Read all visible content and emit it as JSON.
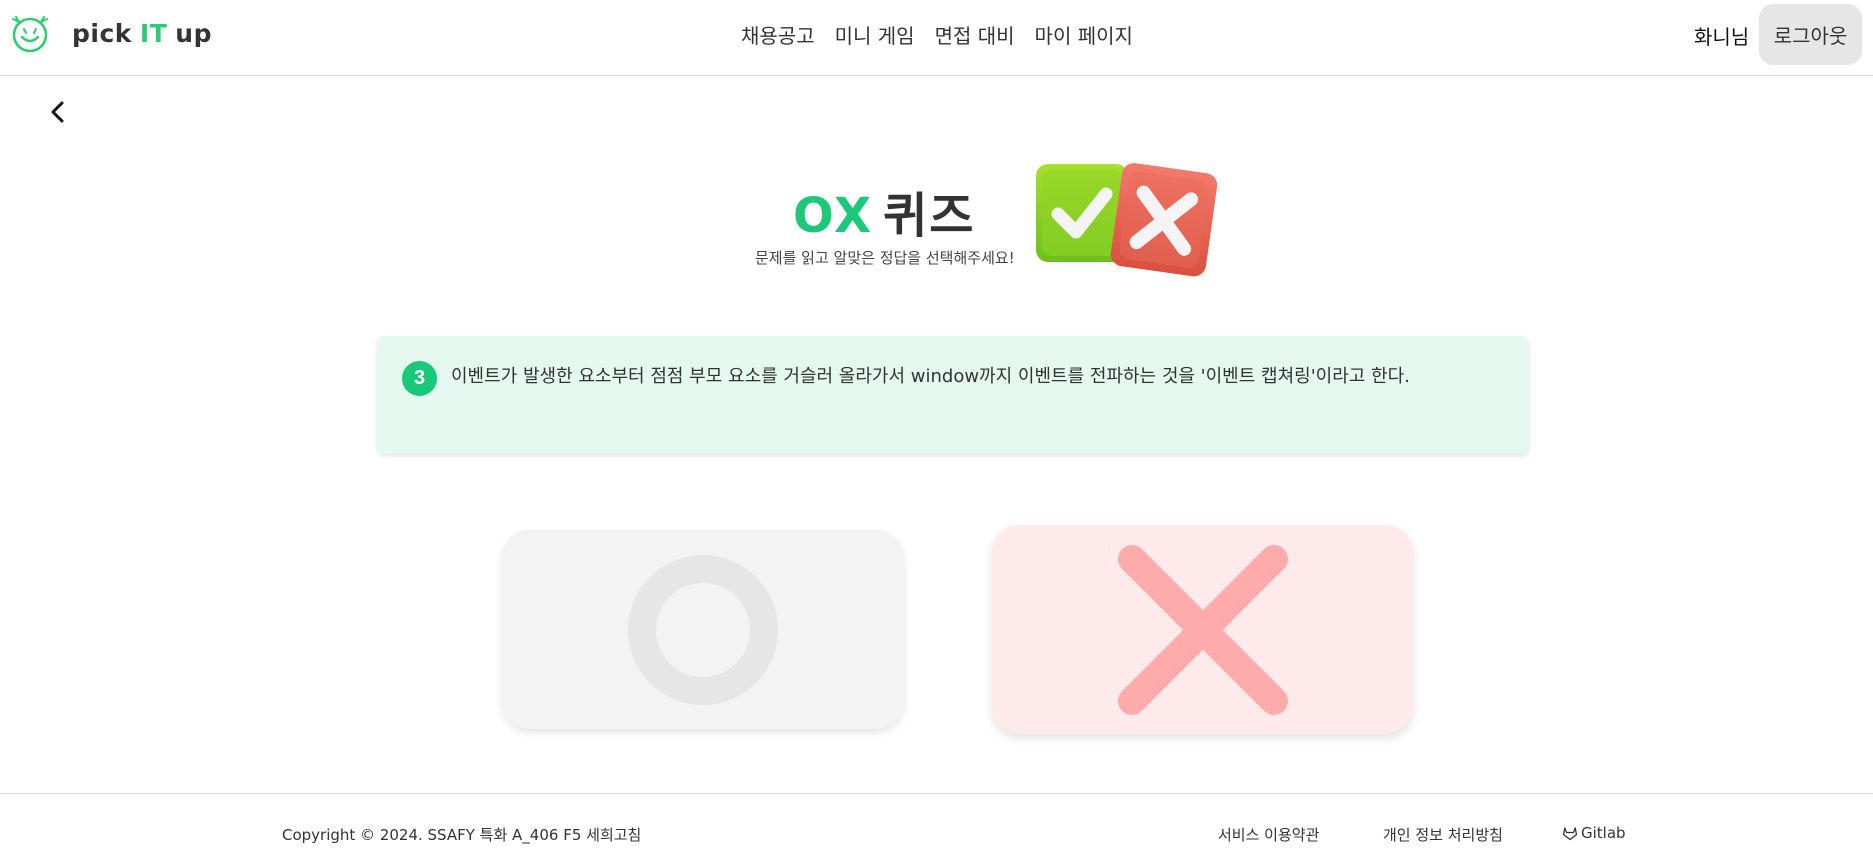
{
  "header": {
    "logo": {
      "pre": "pick",
      "accent": "IT",
      "post": "up",
      "icon": "smiley-logo-icon"
    },
    "nav": [
      {
        "label": "채용공고"
      },
      {
        "label": "미니 게임"
      },
      {
        "label": "면접 대비"
      },
      {
        "label": "마이 페이지"
      }
    ],
    "user_name": "화니님",
    "logout_label": "로그아웃"
  },
  "back_icon": "chevron-left-icon",
  "quiz": {
    "title_accent": "OX",
    "title_rest": "퀴즈",
    "subtitle": "문제를 읽고 알맞은 정답을 선택해주세요!",
    "illustration": "ox-check-cross-icon",
    "question_number": "3",
    "question_text": "이벤트가 발생한 요소부터 점점 부모 요소를 거슬러 올라가서 window까지 이벤트를 전파하는 것을 '이벤트 캡쳐링'이라고 한다.",
    "answers": [
      {
        "icon": "circle-o-icon",
        "state": "unselected"
      },
      {
        "icon": "cross-x-icon",
        "state": "selected"
      }
    ]
  },
  "colors": {
    "accent_green": "#1ec87a",
    "card_bg": "#e4f8ef",
    "x_bg": "#feeaea",
    "x_mark": "#ffabab",
    "o_mark": "#e6e6e6"
  },
  "footer": {
    "copyright": "Copyright © 2024. SSAFY 특화 A_406 F5 세희고침",
    "terms": "서비스 이용약관",
    "privacy": "개인 정보 처리방침",
    "gitlab": "Gitlab",
    "gitlab_icon": "gitlab-icon"
  }
}
